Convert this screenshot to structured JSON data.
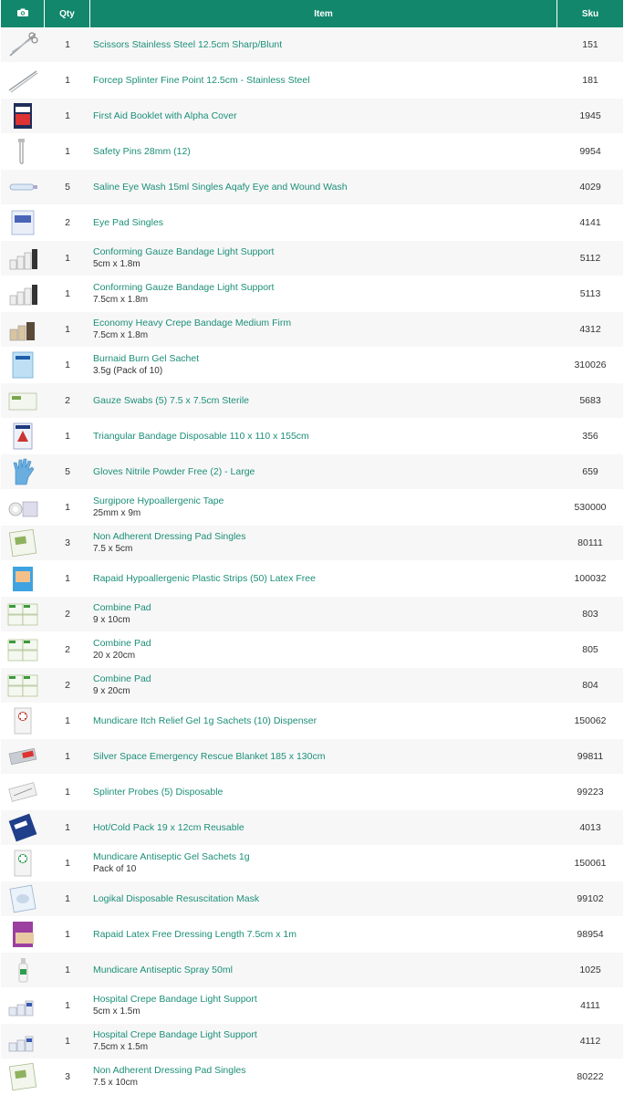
{
  "header": {
    "photo_icon": "camera-icon",
    "qty_label": "Qty",
    "item_label": "Item",
    "sku_label": "Sku"
  },
  "colors": {
    "header_bg": "#12876b",
    "link": "#1c8f78",
    "row_alt": "#f7f7f7"
  },
  "rows": [
    {
      "qty": "1",
      "name": "Scissors Stainless Steel 12.5cm Sharp/Blunt",
      "sub": "",
      "sku": "151",
      "icon": "scissors-thumbnail"
    },
    {
      "qty": "1",
      "name": "Forcep Splinter Fine Point 12.5cm - Stainless Steel",
      "sub": "",
      "sku": "181",
      "icon": "forceps-thumbnail"
    },
    {
      "qty": "1",
      "name": "First Aid Booklet with Alpha Cover",
      "sub": "",
      "sku": "1945",
      "icon": "booklet-thumbnail"
    },
    {
      "qty": "1",
      "name": "Safety Pins 28mm (12)",
      "sub": "",
      "sku": "9954",
      "icon": "safety-pin-thumbnail"
    },
    {
      "qty": "5",
      "name": "Saline Eye Wash 15ml Singles Aqafy Eye and Wound Wash",
      "sub": "",
      "sku": "4029",
      "icon": "saline-tube-thumbnail"
    },
    {
      "qty": "2",
      "name": "Eye Pad Singles",
      "sub": "",
      "sku": "4141",
      "icon": "eye-pad-thumbnail"
    },
    {
      "qty": "1",
      "name": "Conforming Gauze Bandage Light Support",
      "sub": "5cm x 1.8m",
      "sku": "5112",
      "icon": "bandage-rolls-thumbnail"
    },
    {
      "qty": "1",
      "name": "Conforming Gauze Bandage Light Support",
      "sub": "7.5cm x 1.8m",
      "sku": "5113",
      "icon": "bandage-rolls-thumbnail"
    },
    {
      "qty": "1",
      "name": "Economy Heavy Crepe Bandage Medium Firm",
      "sub": "7.5cm x 1.8m",
      "sku": "4312",
      "icon": "crepe-bandage-thumbnail"
    },
    {
      "qty": "1",
      "name": "Burnaid Burn Gel Sachet",
      "sub": "3.5g (Pack of 10)",
      "sku": "310026",
      "icon": "gel-sachet-thumbnail"
    },
    {
      "qty": "2",
      "name": "Gauze Swabs (5) 7.5 x 7.5cm Sterile",
      "sub": "",
      "sku": "5683",
      "icon": "gauze-swab-thumbnail"
    },
    {
      "qty": "1",
      "name": "Triangular Bandage Disposable 110 x 110 x 155cm",
      "sub": "",
      "sku": "356",
      "icon": "triangular-bandage-thumbnail"
    },
    {
      "qty": "5",
      "name": "Gloves Nitrile Powder Free (2) - Large",
      "sub": "",
      "sku": "659",
      "icon": "glove-thumbnail"
    },
    {
      "qty": "1",
      "name": "Surgipore Hypoallergenic Tape",
      "sub": "25mm x 9m",
      "sku": "530000",
      "icon": "tape-roll-thumbnail"
    },
    {
      "qty": "3",
      "name": "Non Adherent Dressing Pad Singles",
      "sub": "7.5 x 5cm",
      "sku": "80111",
      "icon": "dressing-pad-thumbnail"
    },
    {
      "qty": "1",
      "name": "Rapaid Hypoallergenic Plastic Strips (50) Latex Free",
      "sub": "",
      "sku": "100032",
      "icon": "plastic-strips-box-thumbnail"
    },
    {
      "qty": "2",
      "name": "Combine Pad",
      "sub": "9 x 10cm",
      "sku": "803",
      "icon": "combine-pad-thumbnail"
    },
    {
      "qty": "2",
      "name": "Combine Pad",
      "sub": "20 x 20cm",
      "sku": "805",
      "icon": "combine-pad-thumbnail"
    },
    {
      "qty": "2",
      "name": "Combine Pad",
      "sub": "9 x 20cm",
      "sku": "804",
      "icon": "combine-pad-thumbnail"
    },
    {
      "qty": "1",
      "name": "Mundicare Itch Relief Gel 1g Sachets (10) Dispenser",
      "sub": "",
      "sku": "150062",
      "icon": "itch-gel-dispenser-thumbnail"
    },
    {
      "qty": "1",
      "name": "Silver Space Emergency Rescue Blanket 185 x 130cm",
      "sub": "",
      "sku": "99811",
      "icon": "rescue-blanket-thumbnail"
    },
    {
      "qty": "1",
      "name": "Splinter Probes (5) Disposable",
      "sub": "",
      "sku": "99223",
      "icon": "splinter-probes-thumbnail"
    },
    {
      "qty": "1",
      "name": "Hot/Cold Pack 19 x 12cm Reusable",
      "sub": "",
      "sku": "4013",
      "icon": "hot-cold-pack-thumbnail"
    },
    {
      "qty": "1",
      "name": "Mundicare Antiseptic Gel Sachets 1g",
      "sub": "Pack of 10",
      "sku": "150061",
      "icon": "antiseptic-gel-thumbnail"
    },
    {
      "qty": "1",
      "name": "Logikal Disposable Resuscitation Mask",
      "sub": "",
      "sku": "99102",
      "icon": "resuscitation-mask-thumbnail"
    },
    {
      "qty": "1",
      "name": "Rapaid Latex Free Dressing Length 7.5cm x 1m",
      "sub": "",
      "sku": "98954",
      "icon": "dressing-length-thumbnail"
    },
    {
      "qty": "1",
      "name": "Mundicare Antiseptic Spray 50ml",
      "sub": "",
      "sku": "1025",
      "icon": "spray-bottle-thumbnail"
    },
    {
      "qty": "1",
      "name": "Hospital Crepe Bandage Light Support",
      "sub": "5cm x 1.5m",
      "sku": "4111",
      "icon": "hospital-crepe-thumbnail"
    },
    {
      "qty": "1",
      "name": "Hospital Crepe Bandage Light Support",
      "sub": "7.5cm x 1.5m",
      "sku": "4112",
      "icon": "hospital-crepe-thumbnail"
    },
    {
      "qty": "3",
      "name": "Non Adherent Dressing Pad Singles",
      "sub": "7.5 x 10cm",
      "sku": "80222",
      "icon": "dressing-pad-thumbnail"
    }
  ]
}
